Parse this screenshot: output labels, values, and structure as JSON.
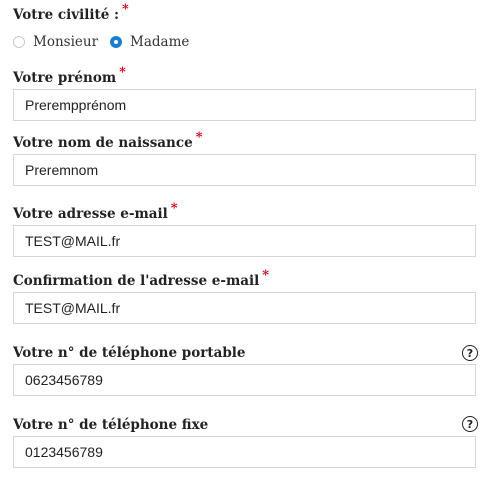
{
  "civility": {
    "label": "Votre civilité :",
    "required_mark": "*",
    "options": [
      {
        "label": "Monsieur",
        "checked": false
      },
      {
        "label": "Madame",
        "checked": true
      }
    ]
  },
  "first_name": {
    "label": "Votre prénom",
    "required_mark": "*",
    "value": "Prerempprénom"
  },
  "birth_name": {
    "label": "Votre nom de naissance",
    "required_mark": "*",
    "value": "Preremnom"
  },
  "email": {
    "label": "Votre adresse e-mail",
    "required_mark": "*",
    "value": "TEST@MAIL.fr"
  },
  "email_confirm": {
    "label": "Confirmation de l'adresse e-mail",
    "required_mark": "*",
    "value": "TEST@MAIL.fr"
  },
  "mobile_phone": {
    "label": "Votre n° de téléphone portable",
    "value": "0623456789",
    "help_icon": "?"
  },
  "landline_phone": {
    "label": "Votre n° de téléphone fixe",
    "value": "0123456789",
    "help_icon": "?"
  },
  "colors": {
    "required": "#d0021b",
    "radio_checked": "#1a7fd0",
    "field_border": "#d6d6d6"
  }
}
